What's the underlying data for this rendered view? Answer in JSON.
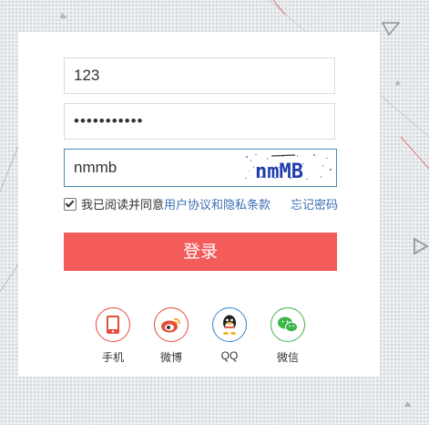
{
  "form": {
    "username_value": "123",
    "password_value": "•••••••••••",
    "captcha_value": "nmmb",
    "captcha_image_text": "nmMB"
  },
  "agreement": {
    "checked": true,
    "prefix": "我已阅读并同意",
    "link": "用户协议和隐私条款"
  },
  "forgot_password": "忘记密码",
  "login_button": "登录",
  "social": [
    {
      "label": "手机",
      "icon": "phone-icon",
      "color": "#e84c3d"
    },
    {
      "label": "微博",
      "icon": "weibo-icon",
      "color": "#e84c3d"
    },
    {
      "label": "QQ",
      "icon": "qq-icon",
      "color": "#2f87d0"
    },
    {
      "label": "微信",
      "icon": "wechat-icon",
      "color": "#3bb648"
    }
  ],
  "colors": {
    "login_button": "#f45b5b",
    "link": "#3c6fb4",
    "focused_border": "#3f8fb0"
  }
}
